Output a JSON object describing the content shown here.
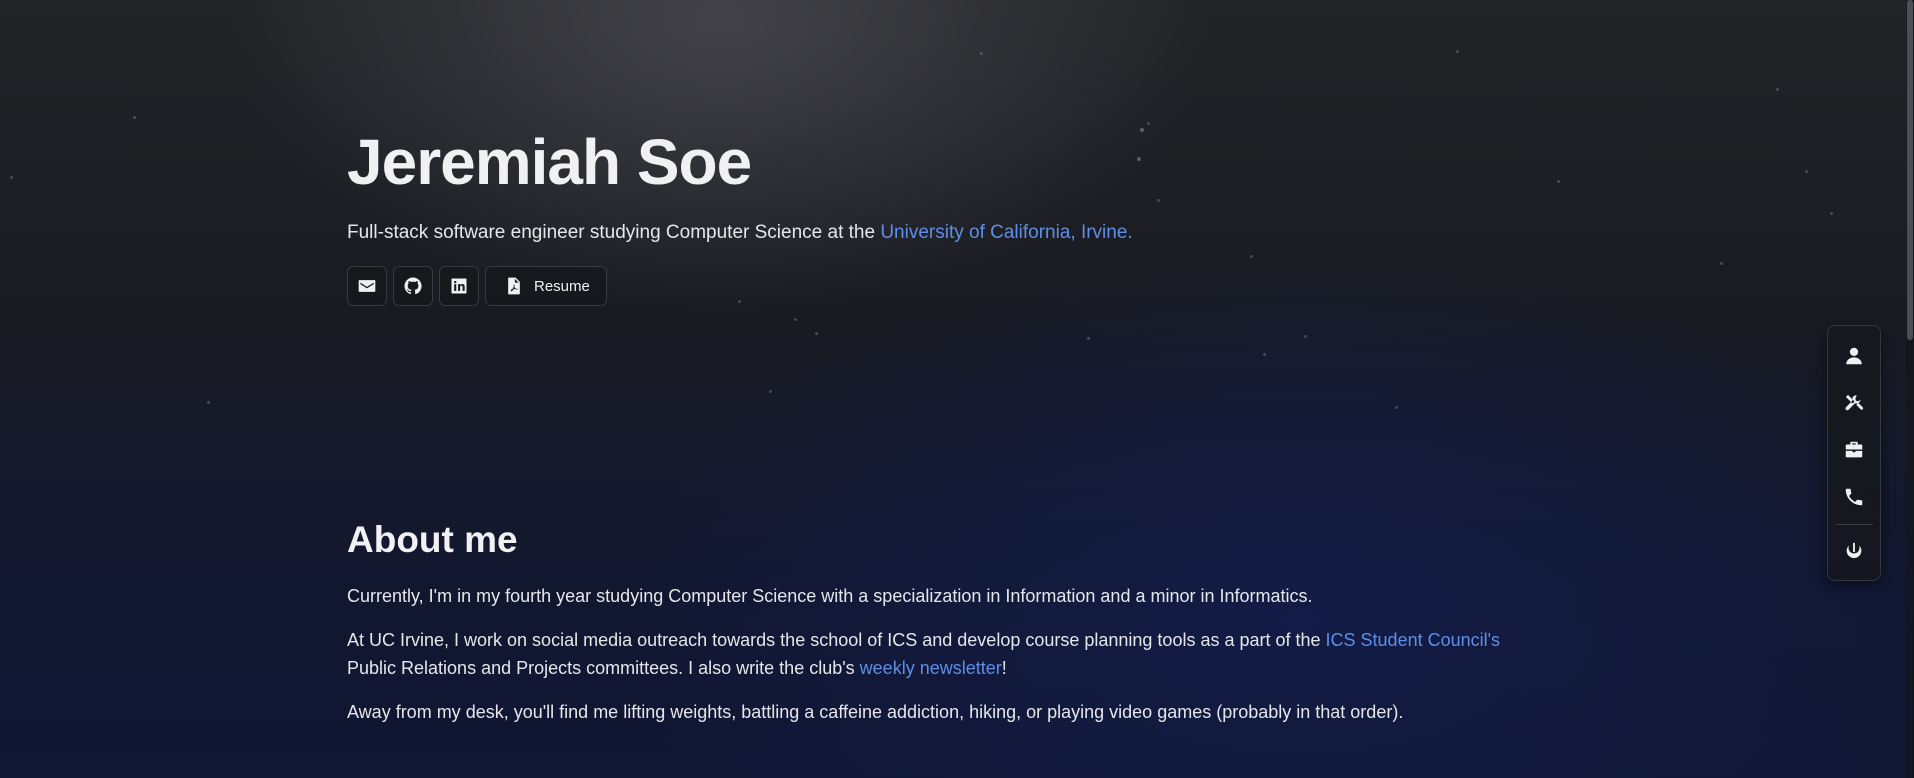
{
  "hero": {
    "name": "Jeremiah Soe",
    "tagline_prefix": "Full-stack software engineer studying Computer Science at the ",
    "tagline_link": "University of California, Irvine.",
    "buttons": {
      "email_icon": "envelope-icon",
      "github_icon": "github-icon",
      "linkedin_icon": "linkedin-icon",
      "resume_icon": "pdf-file-icon",
      "resume_label": "Resume"
    }
  },
  "about": {
    "heading": "About me",
    "p1": "Currently, I'm in my fourth year studying Computer Science with a specialization in Information and a minor in Informatics.",
    "p2_prefix": "At UC Irvine, I work on social media outreach towards the school of ICS and develop course planning tools as a part of the ",
    "p2_link": "ICS Student Council's",
    "p2_middle": " Public Relations and Projects committees. I also write the club's ",
    "p2_link2": "weekly newsletter",
    "p2_suffix": "!",
    "p3": "Away from my desk, you'll find me lifting weights, battling a caffeine addiction, hiking, or playing video games (probably in that order)."
  },
  "side_nav": {
    "items": [
      {
        "icon": "person-icon"
      },
      {
        "icon": "tools-icon"
      },
      {
        "icon": "briefcase-icon"
      },
      {
        "icon": "phone-icon"
      },
      {
        "icon": "power-icon"
      }
    ]
  },
  "colors": {
    "link": "#5e8fe6",
    "text": "#e6e7ea",
    "background_top": "#232427",
    "background_bottom": "#101633"
  }
}
